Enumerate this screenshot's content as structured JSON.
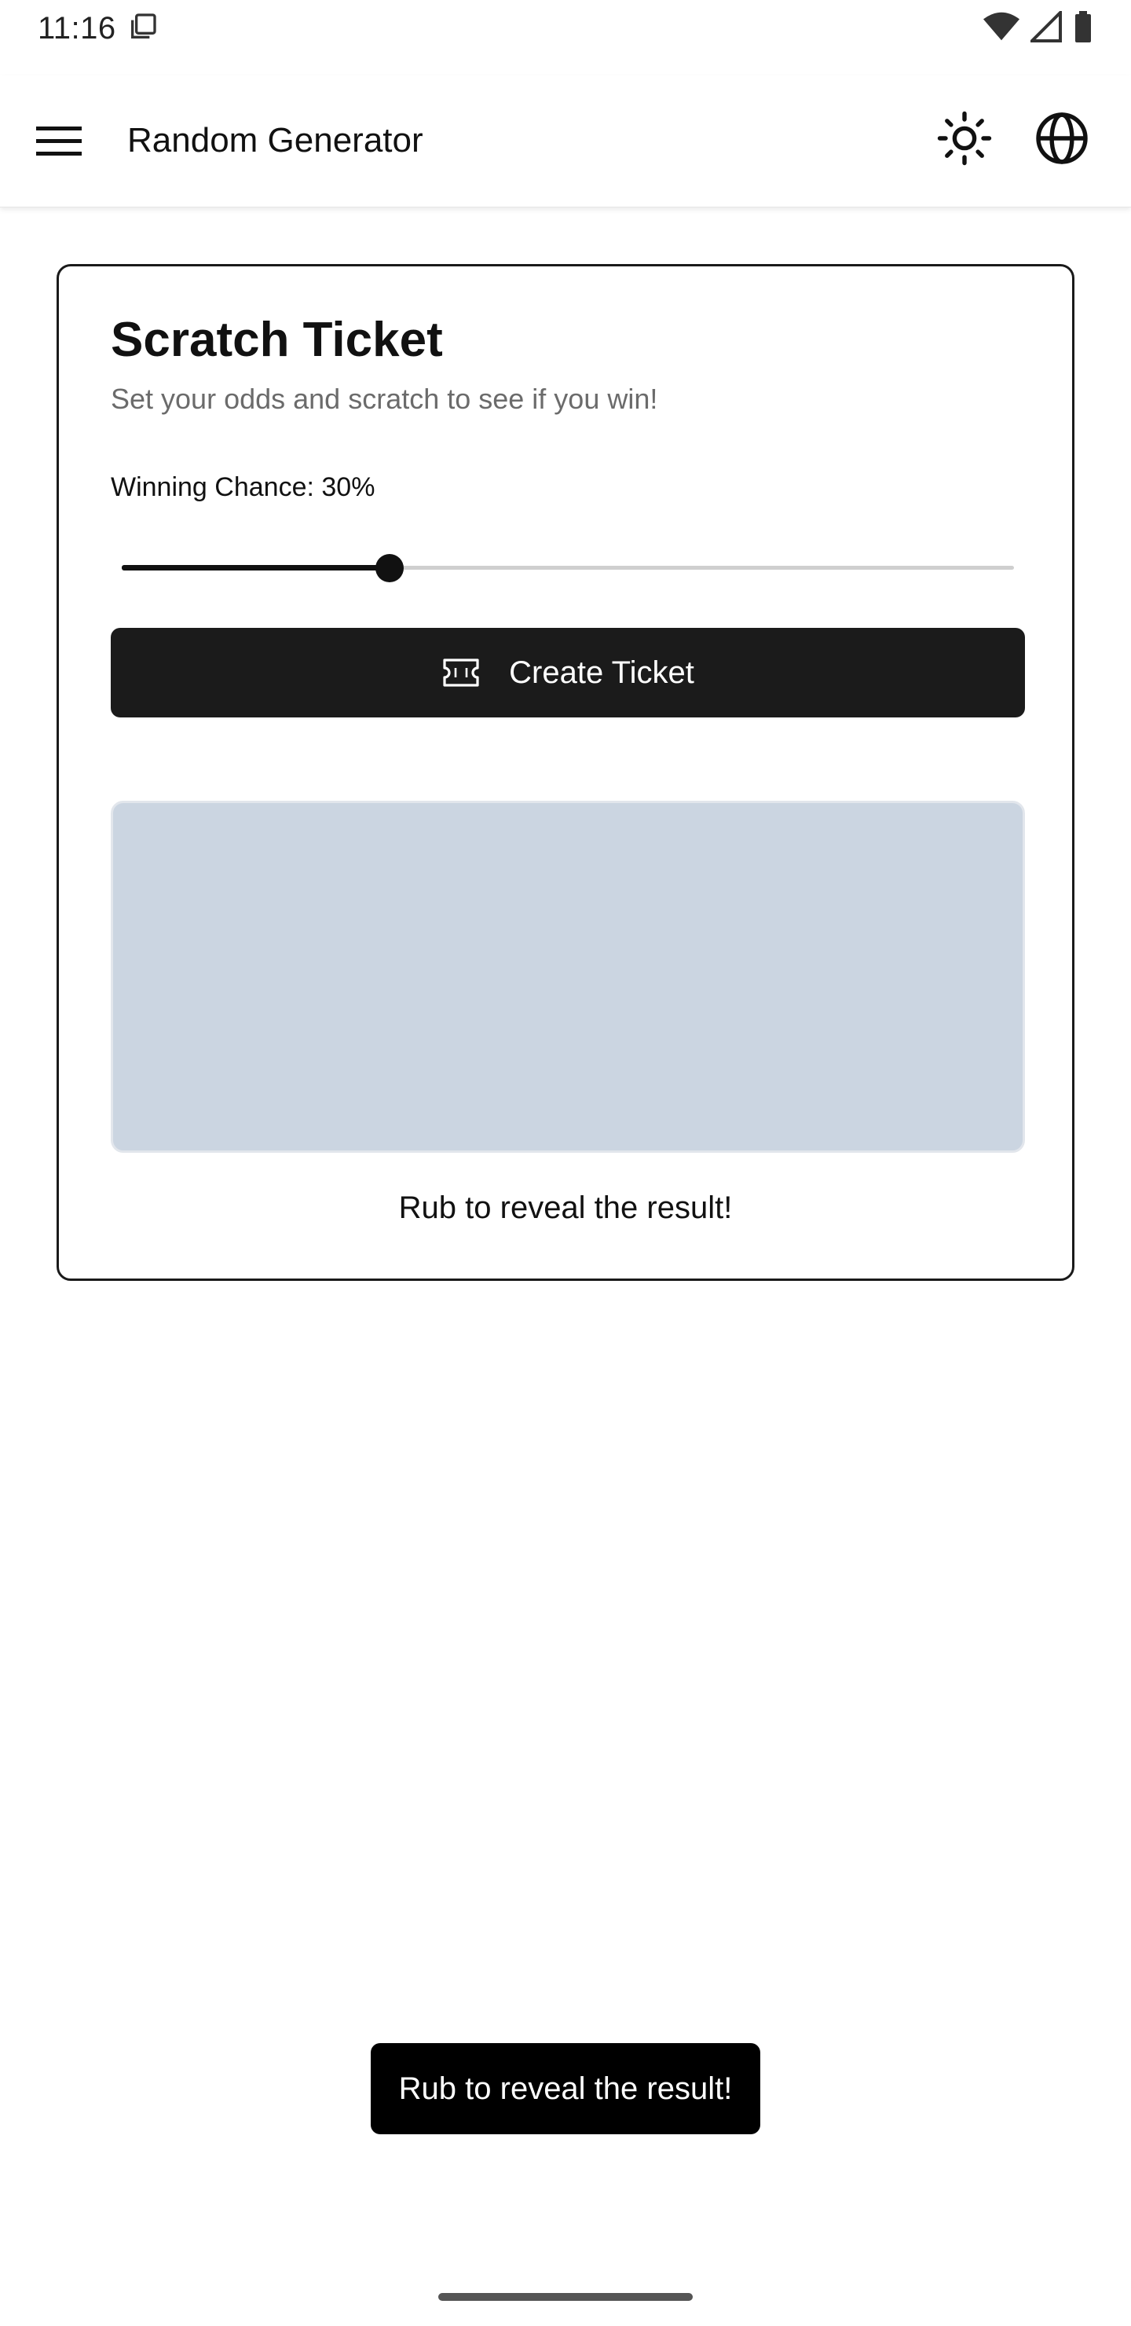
{
  "status_bar": {
    "time": "11:16",
    "icons": [
      "screen-copy-icon",
      "wifi-icon",
      "cell-signal-icon",
      "battery-icon"
    ]
  },
  "app_bar": {
    "title": "Random Generator",
    "icons": [
      "menu-icon",
      "sun-icon",
      "globe-icon"
    ]
  },
  "card": {
    "title": "Scratch Ticket",
    "subtitle": "Set your odds and scratch to see if you win!",
    "chance_label": "Winning Chance:",
    "chance_value": "30%",
    "slider_value": 0.3,
    "create_button_label": "Create Ticket",
    "create_button_icon": "ticket-icon",
    "reveal_hint": "Rub to reveal the result!"
  },
  "toast": {
    "message": "Rub to reveal the result!"
  },
  "colors": {
    "accent": "#1b1b1b",
    "scratch_surface": "#cbd5e1",
    "subtitle": "#6b6b6b"
  }
}
